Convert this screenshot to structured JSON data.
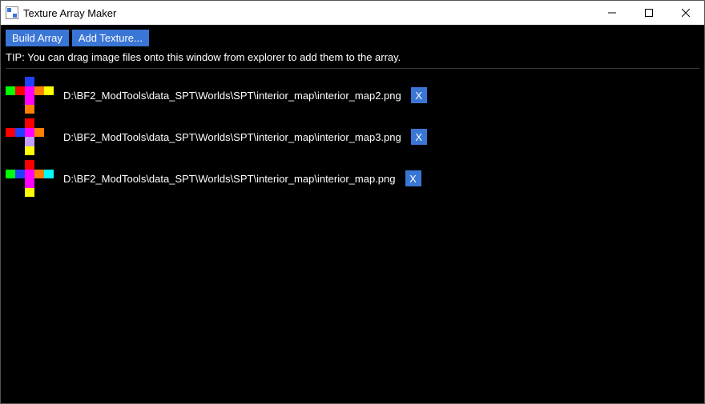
{
  "window": {
    "title": "Texture Array Maker"
  },
  "toolbar": {
    "build_label": "Build Array",
    "add_label": "Add Texture..."
  },
  "tip_text": "TIP: You can drag image files onto this window from explorer to add them to the array.",
  "remove_label": "X",
  "textures": [
    {
      "path": "D:\\BF2_ModTools\\data_SPT\\Worlds\\SPT\\interior_map\\interior_map2.png",
      "cells": [
        "#000000",
        "#000000",
        "#2040ff",
        "#000000",
        "#000000",
        "#00ff00",
        "#ff0000",
        "#ff00ff",
        "#ff8000",
        "#ffff00",
        "#000000",
        "#000000",
        "#ff00ff",
        "#000000",
        "#000000",
        "#000000",
        "#000000",
        "#ff8000",
        "#000000",
        "#000000"
      ]
    },
    {
      "path": "D:\\BF2_ModTools\\data_SPT\\Worlds\\SPT\\interior_map\\interior_map3.png",
      "cells": [
        "#000000",
        "#000000",
        "#ff0000",
        "#000000",
        "#000000",
        "#ff0000",
        "#2040ff",
        "#ff00ff",
        "#ff8000",
        "#000000",
        "#000000",
        "#000000",
        "#c0a0ff",
        "#000000",
        "#000000",
        "#000000",
        "#000000",
        "#ffff00",
        "#000000",
        "#000000"
      ]
    },
    {
      "path": "D:\\BF2_ModTools\\data_SPT\\Worlds\\SPT\\interior_map\\interior_map.png",
      "cells": [
        "#000000",
        "#000000",
        "#ff0000",
        "#000000",
        "#000000",
        "#00ff00",
        "#2040ff",
        "#ff00ff",
        "#ff8000",
        "#00ffff",
        "#000000",
        "#000000",
        "#ff00ff",
        "#000000",
        "#000000",
        "#000000",
        "#000000",
        "#ffff00",
        "#000000",
        "#000000"
      ]
    }
  ]
}
